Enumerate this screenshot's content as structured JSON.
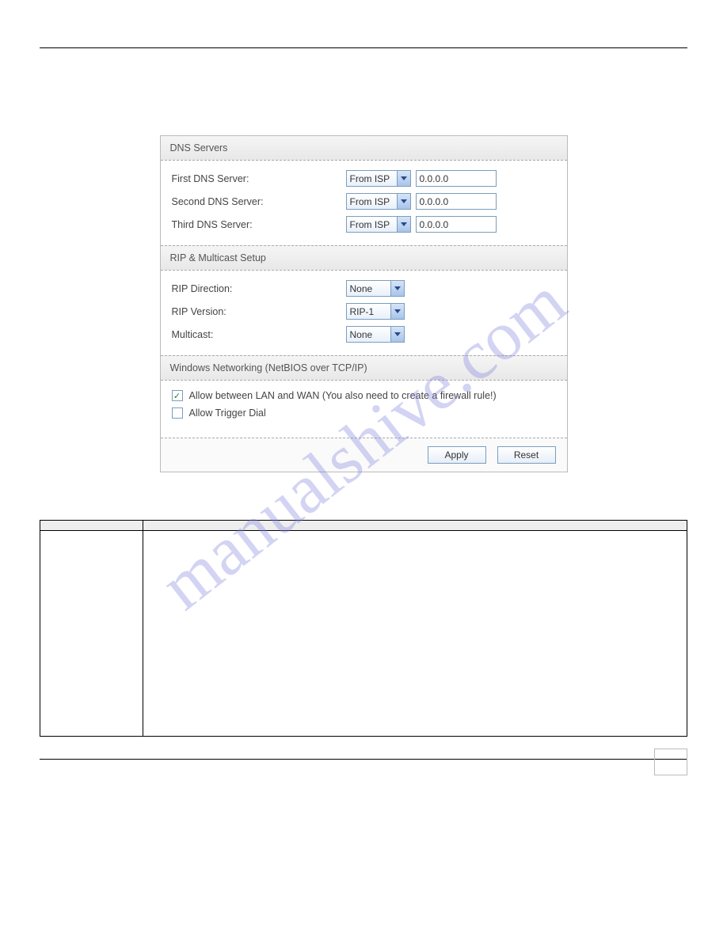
{
  "watermark": "manualshive.com",
  "panel": {
    "dns": {
      "header": "DNS Servers",
      "rows": [
        {
          "label": "First DNS Server:",
          "select": "From ISP",
          "value": "0.0.0.0"
        },
        {
          "label": "Second DNS Server:",
          "select": "From ISP",
          "value": "0.0.0.0"
        },
        {
          "label": "Third DNS Server:",
          "select": "From ISP",
          "value": "0.0.0.0"
        }
      ]
    },
    "rip": {
      "header": "RIP & Multicast Setup",
      "rows": [
        {
          "label": "RIP Direction:",
          "select": "None"
        },
        {
          "label": "RIP Version:",
          "select": "RIP-1"
        },
        {
          "label": "Multicast:",
          "select": "None"
        }
      ]
    },
    "wins": {
      "header": "Windows Networking (NetBIOS over TCP/IP)",
      "checks": [
        {
          "checked": true,
          "label": "Allow between LAN and WAN (You also need to create a firewall rule!)"
        },
        {
          "checked": false,
          "label": "Allow Trigger Dial"
        }
      ]
    },
    "buttons": {
      "apply": "Apply",
      "reset": "Reset"
    }
  },
  "table": {
    "head_label": "",
    "head_desc": "",
    "row1_label": "",
    "row1_desc": ""
  }
}
